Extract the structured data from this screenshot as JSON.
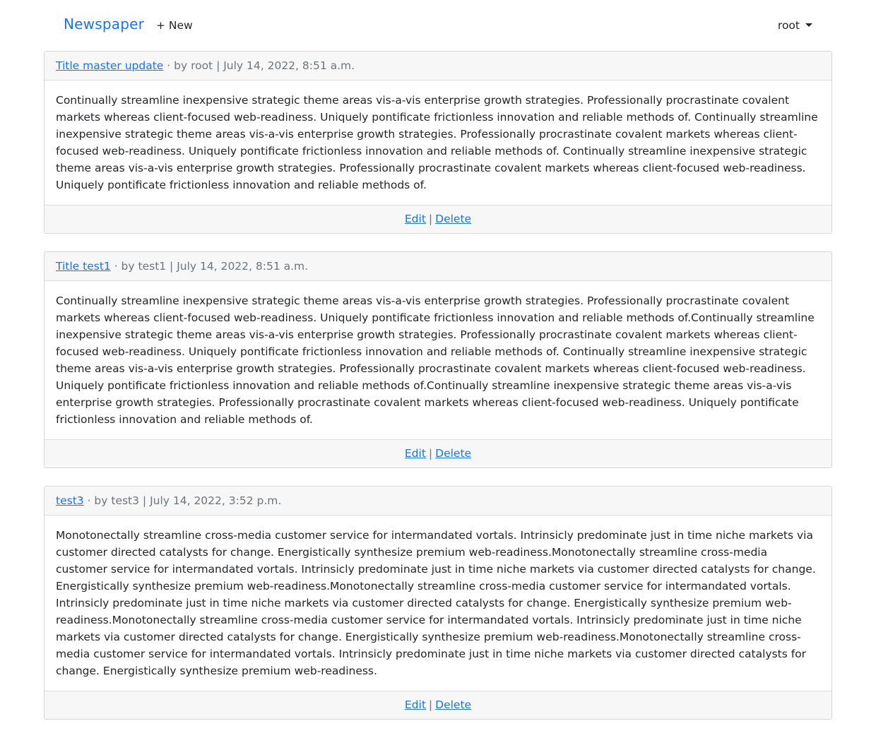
{
  "navbar": {
    "brand": "Newspaper",
    "new_link": "+ New",
    "user": "root"
  },
  "posts": [
    {
      "title": "Title master update",
      "meta": " · by root | July 14, 2022, 8:51 a.m.",
      "body": "Continually streamline inexpensive strategic theme areas vis-a-vis enterprise growth strategies. Professionally procrastinate covalent markets whereas client-focused web-readiness. Uniquely pontificate frictionless innovation and reliable methods of. Continually streamline inexpensive strategic theme areas vis-a-vis enterprise growth strategies. Professionally procrastinate covalent markets whereas client-focused web-readiness. Uniquely pontificate frictionless innovation and reliable methods of. Continually streamline inexpensive strategic theme areas vis-a-vis enterprise growth strategies. Professionally procrastinate covalent markets whereas client-focused web-readiness. Uniquely pontificate frictionless innovation and reliable methods of.",
      "edit": "Edit",
      "sep": "|",
      "delete": "Delete"
    },
    {
      "title": "Title test1",
      "meta": " · by test1 | July 14, 2022, 8:51 a.m.",
      "body": "Continually streamline inexpensive strategic theme areas vis-a-vis enterprise growth strategies. Professionally procrastinate covalent markets whereas client-focused web-readiness. Uniquely pontificate frictionless innovation and reliable methods of.Continually streamline inexpensive strategic theme areas vis-a-vis enterprise growth strategies. Professionally procrastinate covalent markets whereas client-focused web-readiness. Uniquely pontificate frictionless innovation and reliable methods of. Continually streamline inexpensive strategic theme areas vis-a-vis enterprise growth strategies. Professionally procrastinate covalent markets whereas client-focused web-readiness. Uniquely pontificate frictionless innovation and reliable methods of.Continually streamline inexpensive strategic theme areas vis-a-vis enterprise growth strategies. Professionally procrastinate covalent markets whereas client-focused web-readiness. Uniquely pontificate frictionless innovation and reliable methods of.",
      "edit": "Edit",
      "sep": "|",
      "delete": "Delete"
    },
    {
      "title": "test3",
      "meta": " · by test3 | July 14, 2022, 3:52 p.m.",
      "body": "Monotonectally streamline cross-media customer service for intermandated vortals. Intrinsicly predominate just in time niche markets via customer directed catalysts for change. Energistically synthesize premium web-readiness.Monotonectally streamline cross-media customer service for intermandated vortals. Intrinsicly predominate just in time niche markets via customer directed catalysts for change. Energistically synthesize premium web-readiness.Monotonectally streamline cross-media customer service for intermandated vortals. Intrinsicly predominate just in time niche markets via customer directed catalysts for change. Energistically synthesize premium web-readiness.Monotonectally streamline cross-media customer service for intermandated vortals. Intrinsicly predominate just in time niche markets via customer directed catalysts for change. Energistically synthesize premium web-readiness.Monotonectally streamline cross-media customer service for intermandated vortals. Intrinsicly predominate just in time niche markets via customer directed catalysts for change. Energistically synthesize premium web-readiness.",
      "edit": "Edit",
      "sep": "|",
      "delete": "Delete"
    }
  ],
  "colors": {
    "link": "#1a73e8",
    "muted": "#6c757d",
    "card_header_bg": "#f7f7f7",
    "border": "#d6d6d6"
  }
}
